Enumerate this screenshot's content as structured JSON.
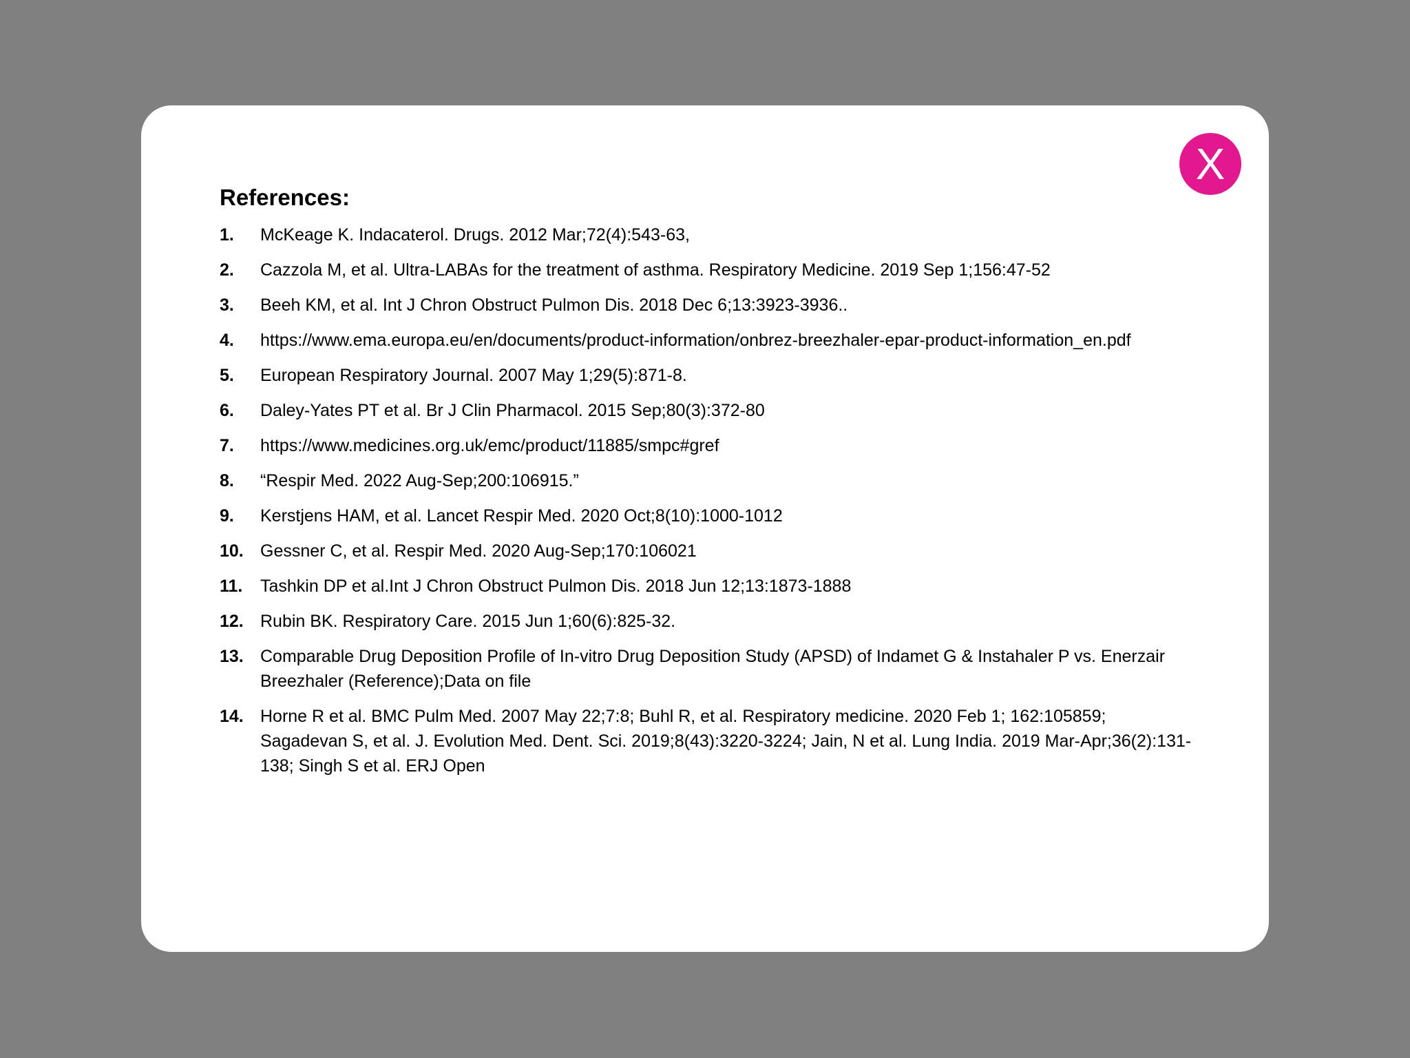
{
  "modal": {
    "close_label": "X",
    "accent_color": "#e2188e",
    "title": "References:",
    "references": [
      {
        "num": "1.",
        "text": "McKeage K. Indacaterol. Drugs. 2012 Mar;72(4):543-63,"
      },
      {
        "num": "2.",
        "text": "Cazzola M, et al. Ultra-LABAs for the treatment of asthma. Respiratory Medicine. 2019 Sep 1;156:47-52"
      },
      {
        "num": "3.",
        "text": "Beeh KM, et al. Int J Chron Obstruct Pulmon Dis. 2018 Dec 6;13:3923-3936.."
      },
      {
        "num": "4.",
        "text": "https://www.ema.europa.eu/en/documents/product-information/onbrez-breezhaler-epar-product-information_en.pdf"
      },
      {
        "num": "5.",
        "text": "European Respiratory Journal. 2007 May 1;29(5):871-8."
      },
      {
        "num": "6.",
        "text": "Daley-Yates PT et al. Br J Clin Pharmacol. 2015 Sep;80(3):372-80"
      },
      {
        "num": "7.",
        "text": "https://www.medicines.org.uk/emc/product/11885/smpc#gref"
      },
      {
        "num": "8.",
        "text": "“Respir Med. 2022 Aug-Sep;200:106915.”"
      },
      {
        "num": "9.",
        "text": "Kerstjens HAM, et al. Lancet Respir Med. 2020 Oct;8(10):1000-1012"
      },
      {
        "num": "10.",
        "text": "Gessner C, et al. Respir Med. 2020 Aug-Sep;170:106021"
      },
      {
        "num": "11.",
        "text": "Tashkin DP et al.Int J Chron Obstruct Pulmon Dis. 2018 Jun 12;13:1873-1888"
      },
      {
        "num": "12.",
        "text": "Rubin BK. Respiratory Care. 2015 Jun 1;60(6):825-32."
      },
      {
        "num": "13.",
        "text": "Comparable Drug Deposition Profile of In-vitro Drug Deposition Study (APSD) of Indamet G & Instahaler P vs. Enerzair Breezhaler (Reference);Data on file"
      },
      {
        "num": "14.",
        "text": "Horne R et al. BMC Pulm Med. 2007 May 22;7:8; Buhl R, et al. Respiratory medicine. 2020 Feb 1; 162:105859; Sagadevan S, et al. J. Evolution Med. Dent. Sci. 2019;8(43):3220-3224; Jain, N et al. Lung India. 2019 Mar-Apr;36(2):131-138; Singh S et al. ERJ Open"
      }
    ]
  }
}
